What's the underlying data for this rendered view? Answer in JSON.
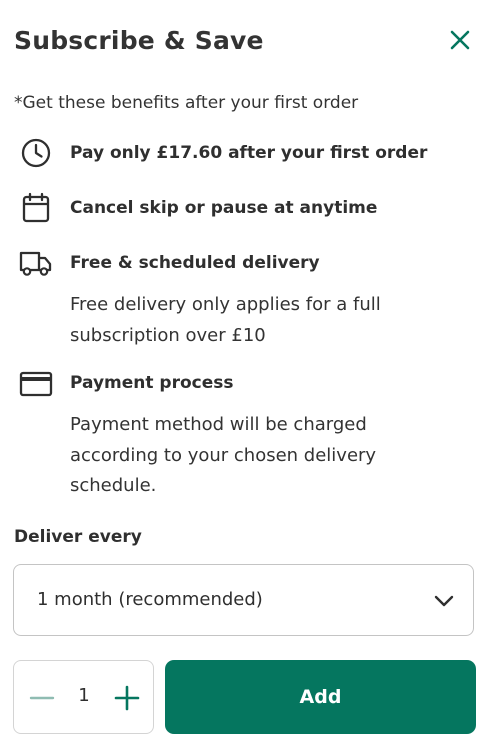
{
  "modal": {
    "title": "Subscribe & Save",
    "close_icon": "close-icon"
  },
  "benefits": {
    "note": "*Get these benefits after your first order",
    "items": [
      {
        "icon": "clock-icon",
        "title": "Pay only £17.60 after your first order",
        "description": ""
      },
      {
        "icon": "calendar-icon",
        "title": "Cancel skip or pause at anytime",
        "description": ""
      },
      {
        "icon": "delivery-truck-icon",
        "title": "Free & scheduled delivery",
        "description": "Free delivery only applies for a full subscription over £10"
      },
      {
        "icon": "credit-card-icon",
        "title": "Payment process",
        "description": "Payment method will be charged according to your chosen delivery schedule."
      }
    ]
  },
  "delivery": {
    "label": "Deliver every",
    "selected": "1 month (recommended)",
    "chevron_icon": "chevron-down-icon"
  },
  "quantity": {
    "value": "1",
    "minus_icon": "minus-icon",
    "plus_icon": "plus-icon"
  },
  "actions": {
    "add_label": "Add"
  },
  "colors": {
    "accent": "#05765f",
    "text": "#2f2f2f",
    "border": "#c4c4c4"
  }
}
